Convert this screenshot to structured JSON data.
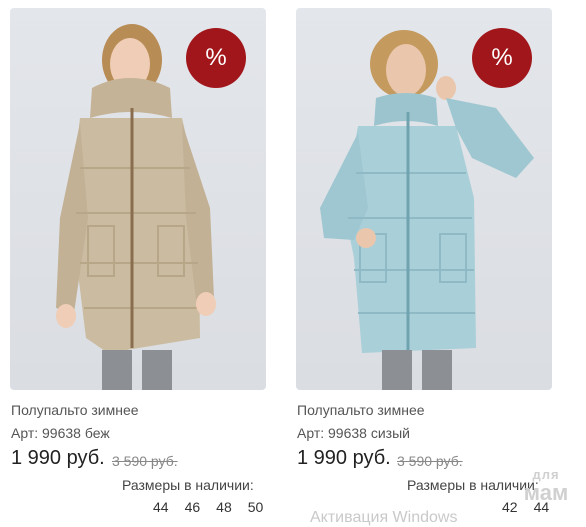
{
  "products": [
    {
      "title": "Полупальто зимнее",
      "article": "Арт: 99638 беж",
      "price": "1 990 руб.",
      "old_price": "3 590 руб.",
      "sizes_label": "Размеры в наличии:",
      "sizes": [
        "44",
        "46",
        "48",
        "50"
      ],
      "badge": "%",
      "coat_color": "#cbbba0"
    },
    {
      "title": "Полупальто зимнее",
      "article": "Арт: 99638 сизый",
      "price": "1 990 руб.",
      "old_price": "3 590 руб.",
      "sizes_label": "Размеры в наличии:",
      "sizes": [
        "42",
        "44"
      ],
      "badge": "%",
      "coat_color": "#a9cfd9"
    }
  ],
  "watermark": {
    "text": "Активация Windows",
    "logo_top": "для",
    "logo_bottom": "мам"
  }
}
